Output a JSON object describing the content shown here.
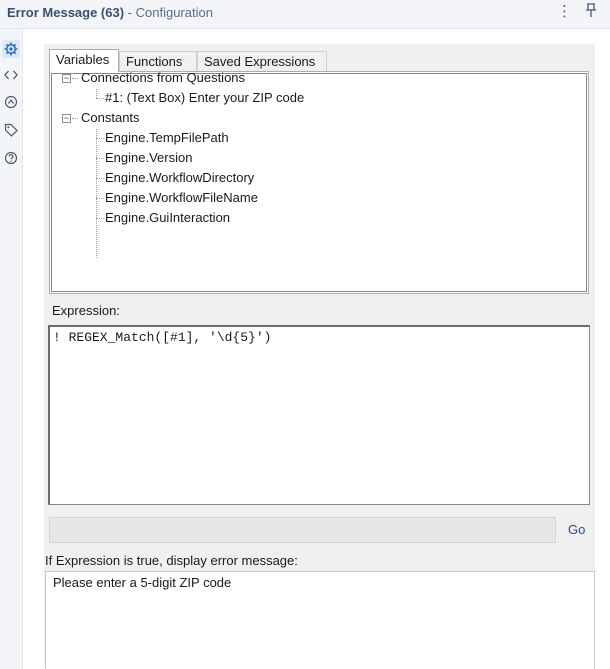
{
  "header": {
    "title_main": "Error Message (63)",
    "title_sub": " - Configuration",
    "menu_icon": "kebab-menu-icon",
    "pin_icon": "pin-icon"
  },
  "sidebar": {
    "items": [
      {
        "icon": "gear-icon",
        "active": true
      },
      {
        "icon": "code-icon",
        "active": false
      },
      {
        "icon": "circle-arrow-icon",
        "active": false
      },
      {
        "icon": "tag-icon",
        "active": false
      },
      {
        "icon": "help-icon",
        "active": false
      }
    ]
  },
  "tabs": [
    {
      "label": "Variables",
      "active": true
    },
    {
      "label": "Functions",
      "active": false
    },
    {
      "label": "Saved Expressions",
      "active": false
    }
  ],
  "tree": {
    "groups": [
      {
        "label": "Connections from Questions",
        "children": [
          "#1: (Text Box) Enter your ZIP code"
        ]
      },
      {
        "label": "Constants",
        "children": [
          "Engine.TempFilePath",
          "Engine.Version",
          "Engine.WorkflowDirectory",
          "Engine.WorkflowFileName",
          "Engine.GuiInteraction"
        ]
      }
    ]
  },
  "expression": {
    "label": "Expression:",
    "value": "! REGEX_Match([#1], '\\d{5}')"
  },
  "go": {
    "label": "Go",
    "field_value": ""
  },
  "error": {
    "label": "If Expression is true, display error message:",
    "message": "Please enter a 5-digit ZIP code"
  },
  "colors": {
    "header_bg": "#f3f5f8",
    "panel_bg": "#f0f0f0",
    "title_color": "#3a5070",
    "accent": "#2a6fc9"
  }
}
